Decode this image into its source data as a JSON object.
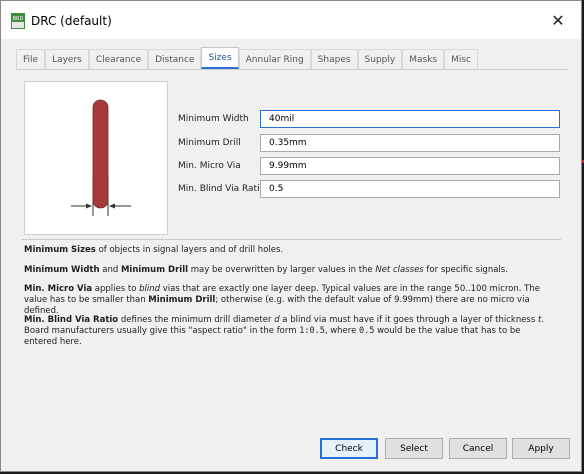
{
  "window": {
    "icon_text": "BRD",
    "title": "DRC (default)",
    "close_glyph": "✕"
  },
  "tabs": [
    {
      "label": "File"
    },
    {
      "label": "Layers"
    },
    {
      "label": "Clearance"
    },
    {
      "label": "Distance"
    },
    {
      "label": "Sizes",
      "active": true
    },
    {
      "label": "Annular Ring"
    },
    {
      "label": "Shapes"
    },
    {
      "label": "Supply"
    },
    {
      "label": "Masks"
    },
    {
      "label": "Misc"
    }
  ],
  "form": {
    "min_width": {
      "label": "Minimum Width",
      "value": "40mil"
    },
    "min_drill": {
      "label": "Minimum Drill",
      "value": "0.35mm"
    },
    "min_micro_via": {
      "label": "Min. Micro Via",
      "value": "9.99mm"
    },
    "min_blind_via_ratio": {
      "label": "Min. Blind Via Ratio",
      "value": "0.5"
    }
  },
  "description": {
    "p1": {
      "b1": "Minimum Sizes",
      "t1": " of objects in signal layers and of drill holes."
    },
    "p2": {
      "b1": "Minimum Width",
      "t1": " and ",
      "b2": "Minimum Drill",
      "t2": " may be overwritten by larger values in the ",
      "i1": "Net classes",
      "t3": " for specific signals."
    },
    "p3": {
      "b1": "Min. Micro Via",
      "t1": " applies to ",
      "i1": "blind",
      "t2": " vias that are exactly one layer deep. Typical values are in the range 50..100 micron. The value has to be smaller than ",
      "b2": "Minimum Drill",
      "t3": "; otherwise (e.g. with the default value of 9.99mm) there are no micro via defined."
    },
    "p4": {
      "b1": "Min. Blind Via Ratio",
      "t1": " defines the minimum drill diameter ",
      "i1": "d",
      "t2": " a blind via must have if it goes through a layer of thickness ",
      "i2": "t",
      "t3": ". Board manufacturers usually give this \"aspect ratio\" in the form ",
      "m1": "1:0.5",
      "t4": ", where ",
      "m2": "0.5",
      "t5": " would be the value that has to be entered here."
    }
  },
  "buttons": {
    "check": "Check",
    "select": "Select",
    "cancel": "Cancel",
    "apply": "Apply"
  },
  "colors": {
    "accent": "#2a6fd6",
    "trace": "#a63a3a",
    "pcb_red": "#c21f26"
  }
}
